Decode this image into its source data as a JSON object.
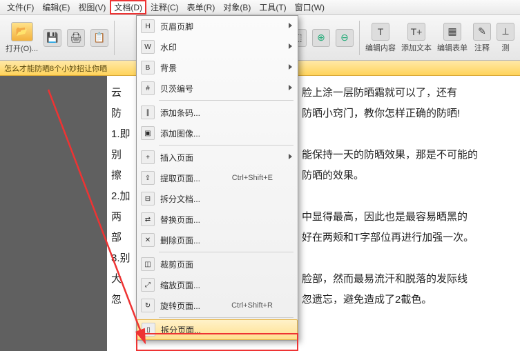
{
  "menubar": {
    "items": [
      {
        "label": "文件(F)"
      },
      {
        "label": "编辑(E)"
      },
      {
        "label": "视图(V)"
      },
      {
        "label": "文档(D)",
        "active": true
      },
      {
        "label": "注释(C)"
      },
      {
        "label": "表单(R)"
      },
      {
        "label": "对象(B)"
      },
      {
        "label": "工具(T)"
      },
      {
        "label": "窗口(W)"
      }
    ]
  },
  "toolbar": {
    "open": "打开(O)...",
    "right_buttons": [
      {
        "name": "edit-content",
        "label": "编辑内容"
      },
      {
        "name": "add-text",
        "label": "添加文本"
      },
      {
        "name": "edit-form",
        "label": "编辑表单"
      },
      {
        "name": "annotate",
        "label": "注释"
      },
      {
        "name": "measure",
        "label": "测"
      }
    ]
  },
  "tab": {
    "title": "怎么才能防晒8个小妙招让你晒"
  },
  "dropdown": {
    "items": [
      {
        "label": "页眉页脚",
        "sub": true,
        "icon": "H"
      },
      {
        "label": "水印",
        "sub": true,
        "icon": "W"
      },
      {
        "label": "背景",
        "sub": true,
        "icon": "B"
      },
      {
        "label": "贝茨编号",
        "sub": true,
        "icon": "#"
      },
      {
        "sep": true
      },
      {
        "label": "添加条码...",
        "icon": "∥"
      },
      {
        "label": "添加图像...",
        "icon": "▣"
      },
      {
        "sep": true
      },
      {
        "label": "插入页面",
        "sub": true,
        "icon": "+"
      },
      {
        "label": "提取页面...",
        "shortcut": "Ctrl+Shift+E",
        "icon": "⇪"
      },
      {
        "label": "拆分文档...",
        "icon": "⊟"
      },
      {
        "label": "替换页面...",
        "icon": "⇄"
      },
      {
        "label": "删除页面...",
        "icon": "✕"
      },
      {
        "sep": true
      },
      {
        "label": "裁剪页面",
        "icon": "◫"
      },
      {
        "label": "缩放页面...",
        "icon": "⤢"
      },
      {
        "label": "旋转页面...",
        "shortcut": "Ctrl+Shift+R",
        "icon": "↻"
      },
      {
        "sep": true
      },
      {
        "label": "拆分页面...",
        "hl": true,
        "icon": "▯"
      }
    ]
  },
  "doc": {
    "lines": [
      "脸上涂一层防晒霜就可以了，还有",
      "防晒小窍门，教你怎样正确的防晒!",
      "",
      "能保持一天的防晒效果，那是不可能的",
      "防晒的效果。",
      "",
      "中显得最高，因此也是最容易晒黑的",
      "好在两颊和T字部位再进行加强一次。",
      "",
      "脸部，然而最易流汗和脱落的发际线",
      "忽遗忘，避免造成了2截色。"
    ],
    "left_frag": [
      "云",
      "防",
      "",
      "1.即",
      "",
      "别",
      "擦",
      "",
      "2.加",
      "",
      "两",
      "部",
      "",
      "3.别",
      "",
      "大",
      "忽"
    ]
  }
}
